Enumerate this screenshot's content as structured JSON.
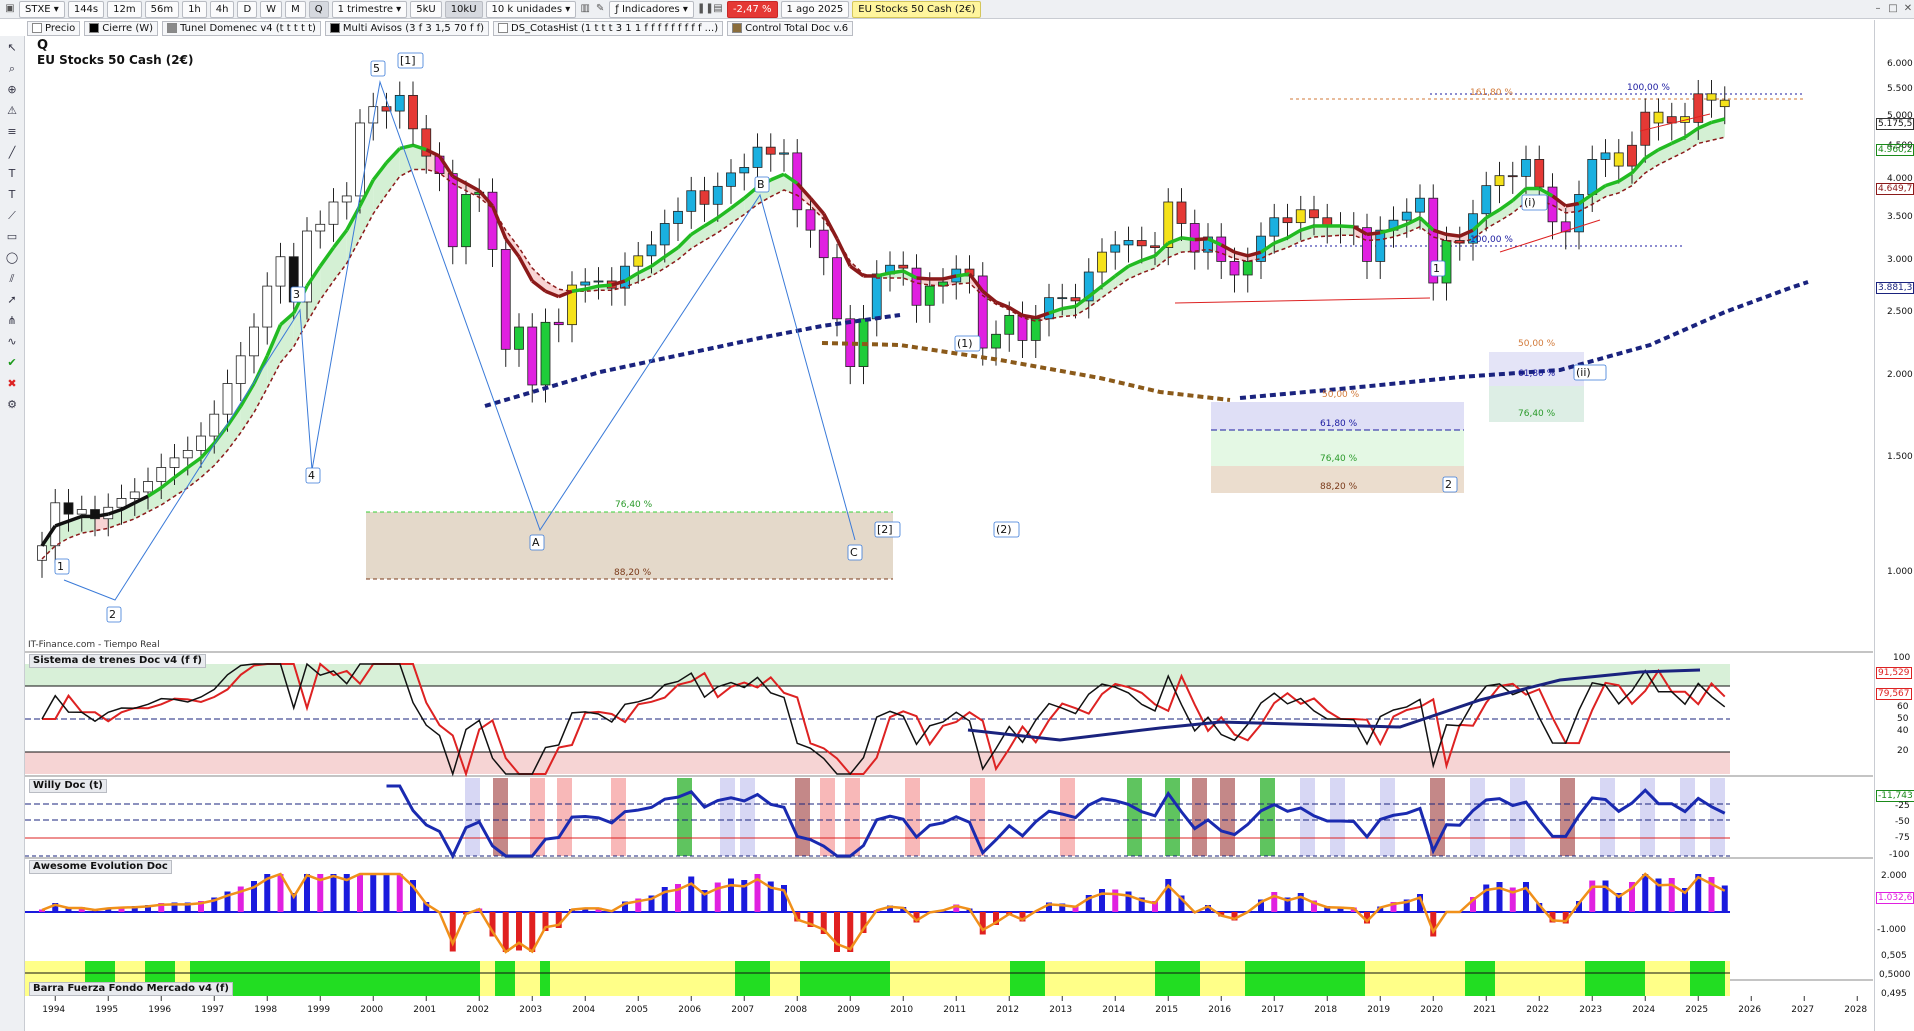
{
  "toolbar": {
    "symbol": "STXE",
    "timeframes": [
      "144s",
      "12m",
      "56m",
      "1h",
      "4h",
      "D",
      "W",
      "M",
      "Q"
    ],
    "active_timeframe": "Q",
    "period": "1 trimestre",
    "units_a": "5kU",
    "units_b": "10kU",
    "units_c": "10 k unidades",
    "indicators": "Indicadores",
    "change": "-2,47 %",
    "date": "1 ago 2025",
    "instrument": "EU Stocks 50 Cash (2€)"
  },
  "indicator_chips": [
    {
      "label": "Precio",
      "color": "#ffffff"
    },
    {
      "label": "Cierre (W)",
      "color": "#000000"
    },
    {
      "label": "Tunel Domenec v4 (t t t t t)",
      "color": "#8a8a8a"
    },
    {
      "label": "Multi Avisos (3 f 3 1,5 70 f f)",
      "color": "#000000"
    },
    {
      "label": "DS_CotasHist (1 t t t 3 1 1 f f f f f f f f f ...)",
      "color": "#ffffff"
    },
    {
      "label": "Control Total Doc v.6",
      "color": "#8a6d3b"
    }
  ],
  "chart_header": {
    "symbol_letter": "Q",
    "name": "EU Stocks 50 Cash (2€)"
  },
  "source_label": "IT-Finance.com - Tiempo Real",
  "panel_titles": {
    "p1": "Sistema de trenes Doc v4 (f f)",
    "p2": "Willy Doc (t)",
    "p3": "Awesome Evolution Doc",
    "p4": "Barra Fuerza Fondo Mercado v4 (f)"
  },
  "right_axis_main": [
    "6.000",
    "5.500",
    "5.000",
    "4.500",
    "4.000",
    "3.500",
    "3.000",
    "2.500",
    "2.000",
    "1.500",
    "1.000"
  ],
  "price_badges": [
    {
      "text": "5.175,5",
      "bg": "#ffffff",
      "fg": "#000000"
    },
    {
      "text": "4.960,2",
      "bg": "#ffffff",
      "fg": "#1a8a1a"
    },
    {
      "text": "4.649,7",
      "bg": "#ffffff",
      "fg": "#8b1a1a"
    },
    {
      "text": "3.881,3",
      "bg": "#ffffff",
      "fg": "#1a237e"
    }
  ],
  "panel_axes": {
    "p1": [
      "100",
      "80",
      "60",
      "50",
      "40",
      "20"
    ],
    "p1_badges": [
      "91,529",
      "79,567"
    ],
    "p2": [
      "-11,743",
      "-25",
      "-50",
      "-75",
      "-100"
    ],
    "p3": [
      "2.000",
      "1.032,6",
      "-1.000"
    ],
    "p4": [
      "0,505",
      "0,5000",
      "0,495"
    ]
  },
  "x_labels": [
    "1994",
    "1995",
    "1996",
    "1997",
    "1998",
    "1999",
    "2000",
    "2001",
    "2002",
    "2003",
    "2004",
    "2005",
    "2006",
    "2007",
    "2008",
    "2009",
    "2010",
    "2011",
    "2012",
    "2013",
    "2014",
    "2015",
    "2016",
    "2017",
    "2018",
    "2019",
    "2020",
    "2021",
    "2022",
    "2023",
    "2024",
    "2025",
    "2026",
    "2027",
    "2028"
  ],
  "wave_labels": [
    "1",
    "2",
    "3",
    "4",
    "5",
    "[1]",
    "A",
    "B",
    "C",
    "[2]",
    "(1)",
    "(2)",
    "1",
    "2",
    "(i)",
    "(ii)"
  ],
  "fib_labels": [
    "76,40 %",
    "88,20 %",
    "61,80 %",
    "76,40 %",
    "88,20 %",
    "50,00 %",
    "61,80 %",
    "76,40 %",
    "50,00 %",
    "161,80 %",
    "100,00 %",
    "100,00 %"
  ],
  "colors": {
    "up_green": "#1fcc3a",
    "ma_green": "#22bb22",
    "ma_red": "#8b1a1a",
    "ma_blue": "#1a237e",
    "ma_brown": "#8b5a1a"
  },
  "chart_data": {
    "type": "candlestick",
    "interval": "quarterly",
    "ylim": [
      800,
      6000
    ],
    "x": [
      "1993-Q4",
      "1994-Q1",
      "1994-Q2",
      "1994-Q3",
      "1994-Q4",
      "1995-Q1",
      "1995-Q2",
      "1995-Q3",
      "1995-Q4",
      "1996-Q1",
      "1996-Q2",
      "1996-Q3",
      "1996-Q4",
      "1997-Q1",
      "1997-Q2",
      "1997-Q3",
      "1997-Q4",
      "1998-Q1",
      "1998-Q2",
      "1998-Q3",
      "1998-Q4",
      "1999-Q1",
      "1999-Q2",
      "1999-Q3",
      "1999-Q4",
      "2000-Q1",
      "2000-Q2",
      "2000-Q3",
      "2000-Q4",
      "2001-Q1",
      "2001-Q2",
      "2001-Q3",
      "2001-Q4",
      "2002-Q1",
      "2002-Q2",
      "2002-Q3",
      "2002-Q4",
      "2003-Q1",
      "2003-Q2",
      "2003-Q3",
      "2003-Q4",
      "2004-Q1",
      "2004-Q2",
      "2004-Q3",
      "2004-Q4",
      "2005-Q1",
      "2005-Q2",
      "2005-Q3",
      "2005-Q4",
      "2006-Q1",
      "2006-Q2",
      "2006-Q3",
      "2006-Q4",
      "2007-Q1",
      "2007-Q2",
      "2007-Q3",
      "2007-Q4",
      "2008-Q1",
      "2008-Q2",
      "2008-Q3",
      "2008-Q4",
      "2009-Q1",
      "2009-Q2",
      "2009-Q3",
      "2009-Q4",
      "2010-Q1",
      "2010-Q2",
      "2010-Q3",
      "2010-Q4",
      "2011-Q1",
      "2011-Q2",
      "2011-Q3",
      "2011-Q4",
      "2012-Q1",
      "2012-Q2",
      "2012-Q3",
      "2012-Q4",
      "2013-Q1",
      "2013-Q2",
      "2013-Q3",
      "2013-Q4",
      "2014-Q1",
      "2014-Q2",
      "2014-Q3",
      "2014-Q4",
      "2015-Q1",
      "2015-Q2",
      "2015-Q3",
      "2015-Q4",
      "2016-Q1",
      "2016-Q2",
      "2016-Q3",
      "2016-Q4",
      "2017-Q1",
      "2017-Q2",
      "2017-Q3",
      "2017-Q4",
      "2018-Q1",
      "2018-Q2",
      "2018-Q3",
      "2018-Q4",
      "2019-Q1",
      "2019-Q2",
      "2019-Q3",
      "2019-Q4",
      "2020-Q1",
      "2020-Q2",
      "2020-Q3",
      "2020-Q4",
      "2021-Q1",
      "2021-Q2",
      "2021-Q3",
      "2021-Q4",
      "2022-Q1",
      "2022-Q2",
      "2022-Q3",
      "2022-Q4",
      "2023-Q1",
      "2023-Q2",
      "2023-Q3",
      "2023-Q4",
      "2024-Q1",
      "2024-Q2",
      "2024-Q3",
      "2024-Q4",
      "2025-Q1",
      "2025-Q2",
      "2025-Q3"
    ],
    "close": [
      1100,
      1280,
      1230,
      1250,
      1210,
      1260,
      1300,
      1330,
      1380,
      1450,
      1500,
      1540,
      1620,
      1750,
      1950,
      2150,
      2380,
      2750,
      3050,
      2600,
      3340,
      3420,
      3700,
      3780,
      4890,
      5180,
      5100,
      5390,
      4790,
      4350,
      4090,
      3160,
      3800,
      3830,
      3130,
      2200,
      2380,
      1940,
      2420,
      2400,
      2760,
      2790,
      2800,
      2730,
      2950,
      3060,
      3180,
      3430,
      3580,
      3850,
      3670,
      3910,
      4100,
      4180,
      4490,
      4380,
      4400,
      3600,
      3350,
      3040,
      2450,
      2070,
      2450,
      2870,
      2960,
      2930,
      2570,
      2750,
      2790,
      2920,
      2850,
      2210,
      2320,
      2480,
      2270,
      2450,
      2640,
      2640,
      2610,
      2890,
      3100,
      3180,
      3230,
      3170,
      3150,
      3700,
      3430,
      3100,
      3270,
      3000,
      2860,
      3000,
      3280,
      3500,
      3440,
      3600,
      3500,
      3400,
      3400,
      3380,
      3000,
      3350,
      3470,
      3570,
      3750,
      2780,
      3230,
      3200,
      3550,
      3920,
      4060,
      4050,
      4300,
      3900,
      3450,
      3330,
      3800,
      4300,
      4400,
      4200,
      4520,
      5080,
      4890,
      5000,
      4900,
      5420,
      5300,
      5180
    ],
    "series": [
      {
        "name": "Tunel (green MA)",
        "values": [
          1100,
          1180,
          1200,
          1220,
          1220,
          1230,
          1250,
          1280,
          1310,
          1350,
          1400,
          1450,
          1500,
          1580,
          1680,
          1800,
          1950,
          2150,
          2400,
          2500,
          2750,
          2950,
          3150,
          3350,
          3650,
          4000,
          4250,
          4470,
          4520,
          4450,
          4350,
          4050,
          3950,
          3850,
          3650,
          3250,
          3050,
          2800,
          2700,
          2650,
          2700,
          2720,
          2750,
          2760,
          2800,
          2880,
          2950,
          3050,
          3150,
          3300,
          3400,
          3500,
          3620,
          3750,
          3900,
          4000,
          4080,
          3950,
          3750,
          3550,
          3250,
          2950,
          2850,
          2850,
          2880,
          2900,
          2830,
          2820,
          2820,
          2850,
          2870,
          2700,
          2600,
          2550,
          2480,
          2460,
          2500,
          2540,
          2560,
          2650,
          2750,
          2850,
          2950,
          3010,
          3060,
          3200,
          3260,
          3240,
          3250,
          3180,
          3100,
          3060,
          3100,
          3200,
          3260,
          3350,
          3400,
          3400,
          3400,
          3390,
          3300,
          3320,
          3360,
          3420,
          3500,
          3350,
          3300,
          3280,
          3350,
          3500,
          3600,
          3720,
          3880,
          3880,
          3780,
          3650,
          3680,
          3800,
          3920,
          3980,
          4100,
          4320,
          4450,
          4550,
          4650,
          4800,
          4900,
          4960
        ]
      },
      {
        "name": "Base (red MA)",
        "values": [
          1050,
          1100,
          1130,
          1150,
          1160,
          1170,
          1190,
          1210,
          1240,
          1270,
          1310,
          1350,
          1400,
          1460,
          1540,
          1640,
          1760,
          1920,
          2100,
          2220,
          2420,
          2620,
          2800,
          2980,
          3250,
          3550,
          3800,
          4050,
          4150,
          4150,
          4100,
          3950,
          3850,
          3760,
          3620,
          3350,
          3150,
          2930,
          2800,
          2720,
          2700,
          2700,
          2710,
          2710,
          2740,
          2790,
          2850,
          2930,
          3020,
          3140,
          3230,
          3320,
          3430,
          3540,
          3670,
          3770,
          3860,
          3790,
          3650,
          3480,
          3250,
          3000,
          2870,
          2830,
          2830,
          2830,
          2780,
          2760,
          2750,
          2770,
          2780,
          2660,
          2580,
          2530,
          2460,
          2430,
          2450,
          2470,
          2480,
          2550,
          2640,
          2730,
          2820,
          2880,
          2930,
          3040,
          3100,
          3110,
          3130,
          3090,
          3030,
          3000,
          3030,
          3100,
          3150,
          3220,
          3270,
          3280,
          3290,
          3290,
          3230,
          3240,
          3270,
          3320,
          3390,
          3270,
          3230,
          3200,
          3250,
          3370,
          3460,
          3560,
          3700,
          3720,
          3660,
          3560,
          3580,
          3670,
          3770,
          3820,
          3920,
          4100,
          4220,
          4320,
          4420,
          4550,
          4600,
          4650
        ]
      }
    ],
    "panel_1_title": "Sistema de trenes Doc v4 (f f)",
    "panel_2_title": "Willy Doc (t)",
    "panel_3_title": "Awesome Evolution Doc",
    "panel_4_title": "Barra Fuerza Fondo Mercado v4 (f)"
  }
}
